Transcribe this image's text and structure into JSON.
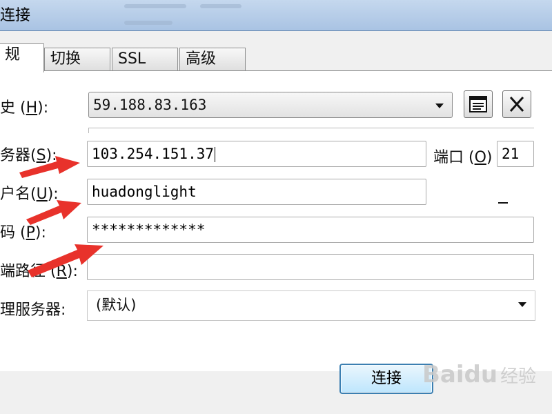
{
  "window": {
    "title": "连接"
  },
  "tabs": [
    {
      "label": "规",
      "active": true
    },
    {
      "label": "切换",
      "active": false
    },
    {
      "label": "SSL",
      "active": false
    },
    {
      "label": "高级",
      "active": false
    }
  ],
  "form": {
    "history": {
      "label": "史",
      "key": "H",
      "value": "59.188.83.163"
    },
    "server": {
      "label": "务器",
      "key": "S",
      "value": "103.254.151.37"
    },
    "port": {
      "label": "端口",
      "key": "O",
      "value": "21"
    },
    "username": {
      "label": "户名",
      "key": "U",
      "value": "huadonglight"
    },
    "password": {
      "label": "码",
      "key": "P",
      "value": "*************"
    },
    "remote_path": {
      "label": "端路径",
      "key": "R",
      "value": ""
    },
    "proxy": {
      "label": "理服务器:",
      "value": "(默认)"
    }
  },
  "buttons": {
    "connect": "连接"
  },
  "watermark": {
    "brand": "Baidu",
    "sub": "经验"
  },
  "colors": {
    "annotation_arrow": "#e8322b",
    "button_border": "#3c7fb1"
  }
}
